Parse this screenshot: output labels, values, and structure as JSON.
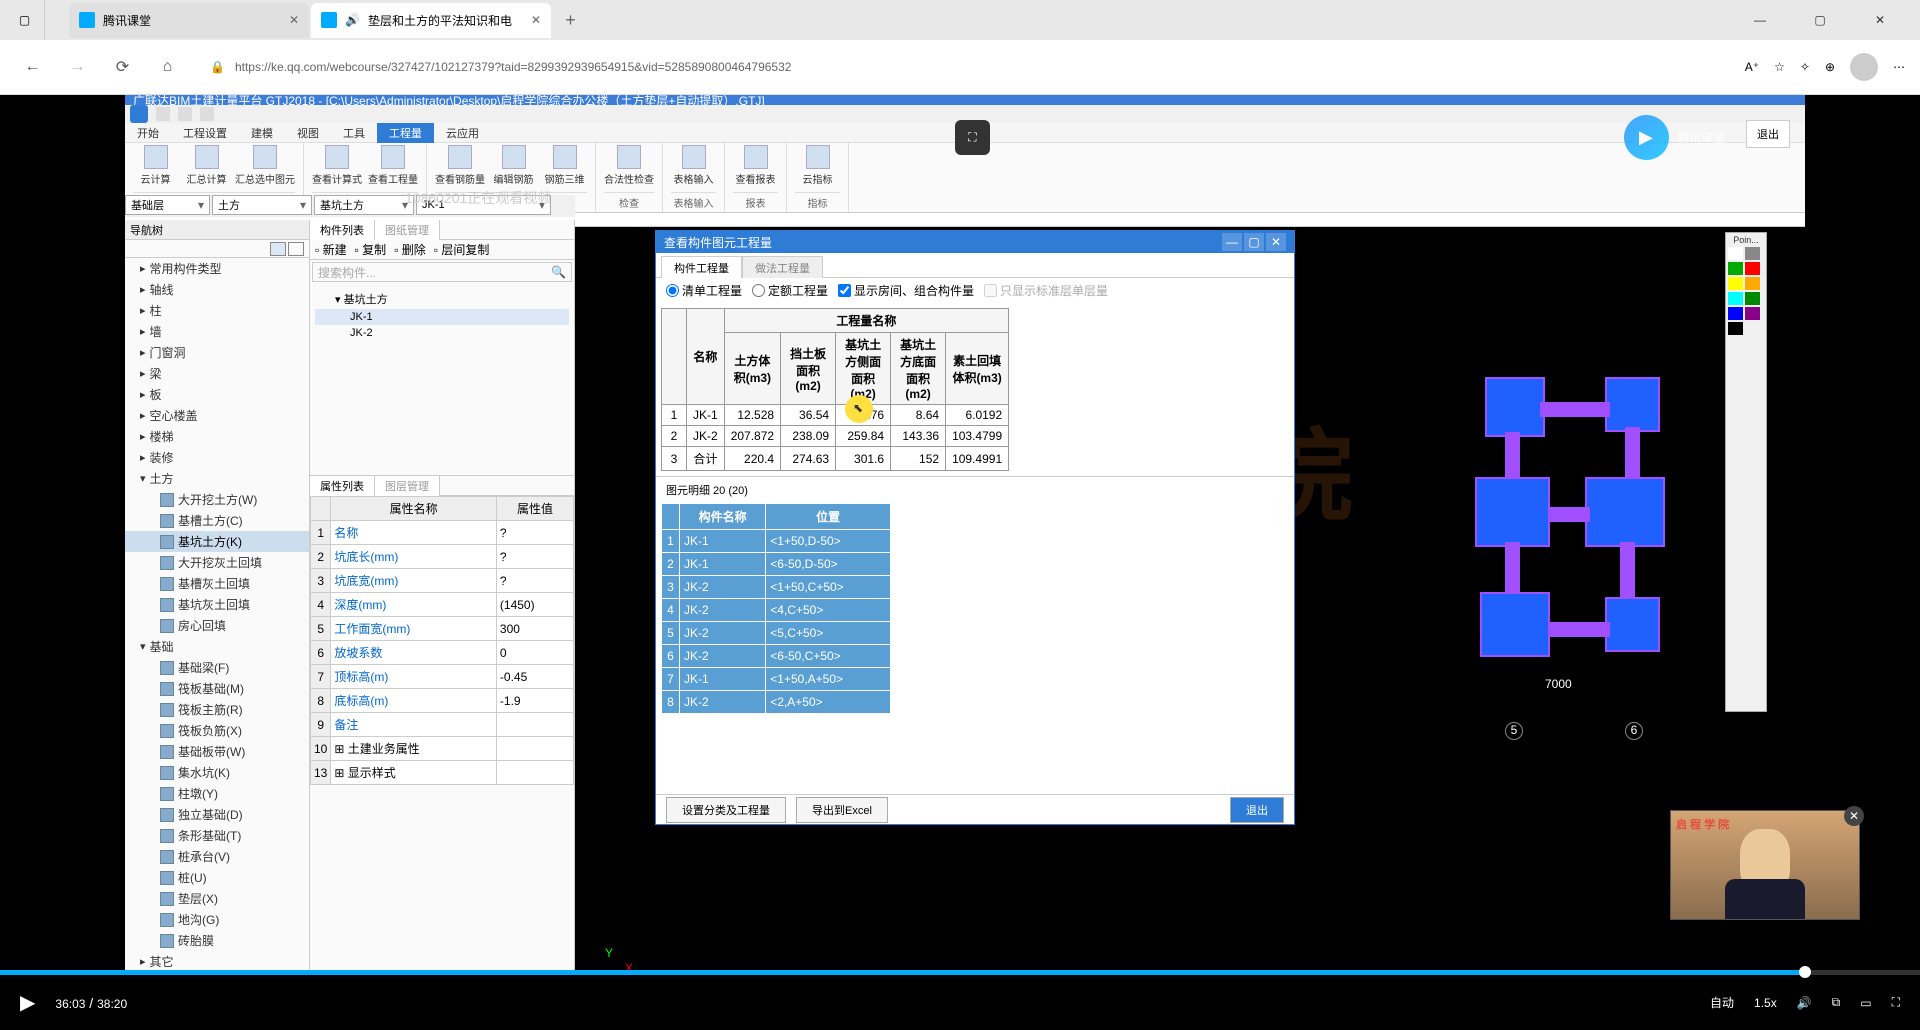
{
  "browser": {
    "tab1": "腾讯课堂",
    "tab2": "垫层和土方的平法知识和电",
    "url": "https://ke.qq.com/webcourse/327427/102127379?taid=8299392939654915&vid=5285890800464796532"
  },
  "app": {
    "title": "广联达BIM土建计量平台 GTJ2018 - [C:\\Users\\Administrator\\Desktop\\启程学院综合办公楼（土方垫层+自动提取）.GTJ]",
    "ribbon_tabs": [
      "开始",
      "工程设置",
      "建模",
      "视图",
      "工具",
      "工程量",
      "云应用"
    ],
    "ribbon_active": 5,
    "ribbon_groups": {
      "g1": {
        "btns": [
          "云计算",
          "汇总计算",
          "汇总选中图元"
        ],
        "label": "汇总"
      },
      "g2": {
        "btns": [
          "查看计算式",
          "查看工程量"
        ],
        "label": "土建计算结果"
      },
      "g3": {
        "btns": [
          "查看钢筋量",
          "编辑钢筋",
          "钢筋三维"
        ],
        "label": "钢筋计算结果"
      },
      "g4": {
        "btns": [
          "合法性检查"
        ],
        "label": "检查"
      },
      "g5": {
        "btns": [
          "表格输入"
        ],
        "label": "表格输入"
      },
      "g6": {
        "btns": [
          "查看报表"
        ],
        "label": "报表"
      },
      "g7": {
        "btns": [
          "云指标"
        ],
        "label": "指标"
      }
    },
    "selectors": [
      "基础层",
      "土方",
      "基坑土方",
      "JK-1"
    ]
  },
  "nav_title": "导航树",
  "nav_view_toggle": [
    "列表",
    "图标"
  ],
  "tree": [
    {
      "l": "常用构件类型",
      "p": 0
    },
    {
      "l": "轴线",
      "p": 0
    },
    {
      "l": "柱",
      "p": 0
    },
    {
      "l": "墙",
      "p": 0
    },
    {
      "l": "门窗洞",
      "p": 0
    },
    {
      "l": "梁",
      "p": 0
    },
    {
      "l": "板",
      "p": 0
    },
    {
      "l": "空心楼盖",
      "p": 0
    },
    {
      "l": "楼梯",
      "p": 0
    },
    {
      "l": "装修",
      "p": 0
    },
    {
      "l": "土方",
      "p": 0,
      "exp": true
    },
    {
      "l": "大开挖土方(W)",
      "p": 1
    },
    {
      "l": "基槽土方(C)",
      "p": 1
    },
    {
      "l": "基坑土方(K)",
      "p": 1,
      "sel": true
    },
    {
      "l": "大开挖灰土回填",
      "p": 1
    },
    {
      "l": "基槽灰土回填",
      "p": 1
    },
    {
      "l": "基坑灰土回填",
      "p": 1
    },
    {
      "l": "房心回填",
      "p": 1
    },
    {
      "l": "基础",
      "p": 0,
      "exp": true
    },
    {
      "l": "基础梁(F)",
      "p": 1
    },
    {
      "l": "筏板基础(M)",
      "p": 1
    },
    {
      "l": "筏板主筋(R)",
      "p": 1
    },
    {
      "l": "筏板负筋(X)",
      "p": 1
    },
    {
      "l": "基础板带(W)",
      "p": 1
    },
    {
      "l": "集水坑(K)",
      "p": 1
    },
    {
      "l": "柱墩(Y)",
      "p": 1
    },
    {
      "l": "独立基础(D)",
      "p": 1
    },
    {
      "l": "条形基础(T)",
      "p": 1
    },
    {
      "l": "桩承台(V)",
      "p": 1
    },
    {
      "l": "桩(U)",
      "p": 1
    },
    {
      "l": "垫层(X)",
      "p": 1
    },
    {
      "l": "地沟(G)",
      "p": 1
    },
    {
      "l": "砖胎膜",
      "p": 1
    },
    {
      "l": "其它",
      "p": 0
    }
  ],
  "mid": {
    "tabs": [
      "构件列表",
      "图纸管理"
    ],
    "toolbar": [
      "新建",
      "复制",
      "删除",
      "层间复制"
    ],
    "search_placeholder": "搜索构件...",
    "items": [
      "基坑土方",
      "JK-1",
      "JK-2"
    ],
    "prop_tabs": [
      "属性列表",
      "图层管理"
    ],
    "prop_headers": [
      "属性名称",
      "属性值"
    ],
    "props": [
      {
        "n": "1",
        "name": "名称",
        "val": "?"
      },
      {
        "n": "2",
        "name": "坑底长(mm)",
        "val": "?"
      },
      {
        "n": "3",
        "name": "坑底宽(mm)",
        "val": "?"
      },
      {
        "n": "4",
        "name": "深度(mm)",
        "val": "(1450)"
      },
      {
        "n": "5",
        "name": "工作面宽(mm)",
        "val": "300"
      },
      {
        "n": "6",
        "name": "放坡系数",
        "val": "0"
      },
      {
        "n": "7",
        "name": "顶标高(m)",
        "val": "-0.45"
      },
      {
        "n": "8",
        "name": "底标高(m)",
        "val": "-1.9"
      },
      {
        "n": "9",
        "name": "备注",
        "val": ""
      },
      {
        "n": "10",
        "name": "土建业务属性",
        "val": "",
        "header": true
      },
      {
        "n": "13",
        "name": "显示样式",
        "val": "",
        "header": true
      }
    ]
  },
  "dialog": {
    "title": "查看构件图元工程量",
    "tabs": [
      "构件工程量",
      "做法工程量"
    ],
    "opt_qingdan": "清单工程量",
    "opt_dinge": "定额工程量",
    "chk_fangjian": "显示房间、组合构件量",
    "chk_biaozhun": "只显示标准层单层量",
    "table_group_header": "工程量名称",
    "headers": [
      "名称",
      "土方体积(m3)",
      "挡土板面积(m2)",
      "基坑土方侧面面积(m2)",
      "基坑土方底面面积(m2)",
      "素土回填体积(m3)"
    ],
    "rows": [
      {
        "i": "1",
        "n": "JK-1",
        "v": [
          "12.528",
          "36.54",
          "41.76",
          "8.64",
          "6.0192"
        ]
      },
      {
        "i": "2",
        "n": "JK-2",
        "v": [
          "207.872",
          "238.09",
          "259.84",
          "143.36",
          "103.4799"
        ]
      },
      {
        "i": "3",
        "n": "合计",
        "v": [
          "220.4",
          "274.63",
          "301.6",
          "152",
          "109.4991"
        ]
      }
    ],
    "detail_label": "图元明细 20 (20)",
    "detail_headers": [
      "构件名称",
      "位置"
    ],
    "details": [
      {
        "i": "1",
        "n": "JK-1",
        "p": "<1+50,D-50>"
      },
      {
        "i": "2",
        "n": "JK-1",
        "p": "<6-50,D-50>"
      },
      {
        "i": "3",
        "n": "JK-2",
        "p": "<1+50,C+50>"
      },
      {
        "i": "4",
        "n": "JK-2",
        "p": "<4,C+50>"
      },
      {
        "i": "5",
        "n": "JK-2",
        "p": "<5,C+50>"
      },
      {
        "i": "6",
        "n": "JK-2",
        "p": "<6-50,C+50>"
      },
      {
        "i": "7",
        "n": "JK-1",
        "p": "<1+50,A+50>"
      },
      {
        "i": "8",
        "n": "JK-2",
        "p": "<2,A+50>"
      }
    ],
    "btn_settings": "设置分类及工程量",
    "btn_export": "导出到Excel",
    "btn_exit": "退出"
  },
  "drawing": {
    "dim_7000": "7000",
    "axis_5": "5",
    "axis_6": "6"
  },
  "brand": "腾讯课堂",
  "exit_label": "退出",
  "point_label": "Poin...",
  "overlay_viewing": "10860201正在观看视频",
  "video": {
    "current": "36:03",
    "total": "38:20",
    "auto": "自动",
    "speed": "1.5x"
  },
  "watermark": "Start启程学院"
}
